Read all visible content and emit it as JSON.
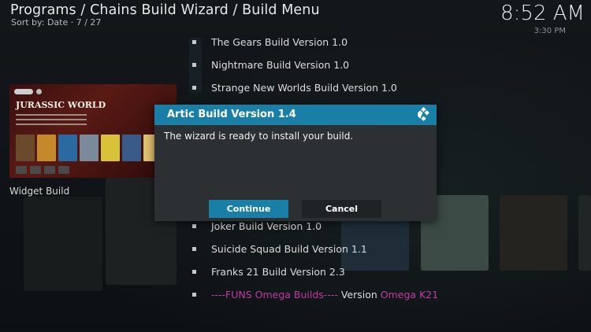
{
  "header": {
    "title": "Programs / Chains Build Wizard / Build Menu",
    "sort": "Sort by: Date",
    "position": "7 / 27",
    "time": "8:52 AM",
    "secondary_time": "3:30 PM"
  },
  "widget": {
    "title": "JURASSIC WORLD",
    "label": "Widget Build"
  },
  "builds_above": [
    "The Gears Build Version 1.0",
    "Nightmare Build Version 1.0",
    "Strange New Worlds Build Version 1.0"
  ],
  "builds_below": [
    "Joker Build Version 1.0",
    "Suicide Squad Build Version 1.1",
    "Franks 21 Build Version 2.3"
  ],
  "omega_item": {
    "prefix": "----FUNS Omega Builds----",
    "middle": "Version",
    "suffix": "Omega K21"
  },
  "dialog": {
    "title": "Artic Build Version 1.4",
    "message": "The wizard is ready to install your build.",
    "continue_label": "Continue",
    "cancel_label": "Cancel"
  },
  "colors": {
    "accent": "#1a7fa6",
    "highlight_text": "#c23aa8"
  }
}
